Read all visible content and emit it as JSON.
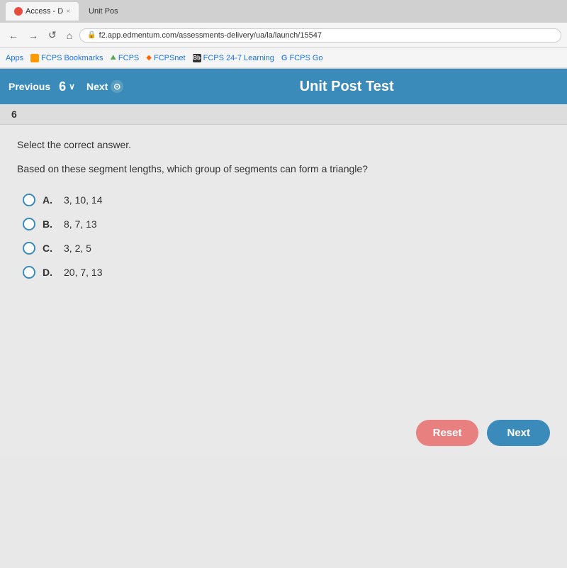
{
  "browser": {
    "tab": {
      "favicon_color": "#e74c3c",
      "label": "Access - D",
      "close": "×"
    },
    "unit_pos_tab": "Unit Pos",
    "nav": {
      "back_icon": "←",
      "forward_icon": "→",
      "refresh_icon": "↺",
      "home_icon": "⌂",
      "address": "f2.app.edmentum.com/assessments-delivery/ua/la/launch/15547",
      "lock_icon": "🔒"
    },
    "bookmarks": [
      {
        "label": "Apps",
        "icon": "grid"
      },
      {
        "label": "FCPS Bookmarks",
        "icon": "bookmark"
      },
      {
        "label": "FCPS",
        "icon": "fcps"
      },
      {
        "label": "FCPSnet",
        "icon": "fcpsnet"
      },
      {
        "label": "FCPS 24-7 Learning",
        "icon": "bb"
      },
      {
        "label": "FCPS Go",
        "icon": "G"
      }
    ]
  },
  "app_nav": {
    "previous_label": "Previous",
    "question_number": "6",
    "dropdown_arrow": "∨",
    "next_label": "Next",
    "next_icon": "⊙",
    "title": "Unit Post Test"
  },
  "question": {
    "number": "6",
    "instruction": "Select the correct answer.",
    "text": "Based on these segment lengths, which group of segments can form a triangle?",
    "options": [
      {
        "id": "A",
        "text": "3, 10, 14"
      },
      {
        "id": "B",
        "text": "8, 7, 13"
      },
      {
        "id": "C",
        "text": "3, 2, 5"
      },
      {
        "id": "D",
        "text": "20, 7, 13"
      }
    ]
  },
  "actions": {
    "reset_label": "Reset",
    "next_label": "Next"
  },
  "colors": {
    "nav_blue": "#3b8bba",
    "reset_pink": "#e88080",
    "next_blue": "#3b8bba"
  }
}
